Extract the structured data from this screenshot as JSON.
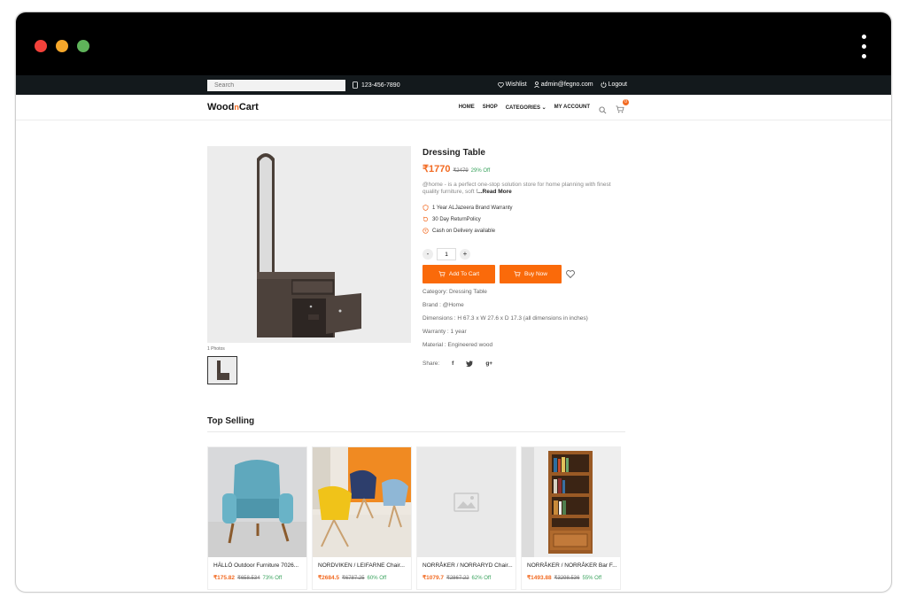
{
  "topbar": {
    "search_placeholder": "Search",
    "phone": "123-456-7890",
    "wishlist": "Wishlist",
    "email": "admin@fegno.com",
    "logout": "Logout"
  },
  "brand": {
    "part1": "Wood",
    "part2": "n",
    "part3": "Cart"
  },
  "nav": {
    "home": "HOME",
    "shop": "SHOP",
    "categories": "CATEGORIES",
    "account": "MY ACCOUNT",
    "cart_count": "0"
  },
  "product": {
    "title": "Dressing Table",
    "price": "₹1770",
    "mrp": "₹2479",
    "off": "29% Off",
    "desc": "@home - is a perfect one-stop solution store for home planning with finest quality furniture, soft f",
    "read_more": "...Read More",
    "features": [
      "1 Year ALJazeera Brand Warranty",
      "30 Day ReturnPolicy",
      "Cash on Delivery available"
    ],
    "qty": "1",
    "add_to_cart": "Add To Cart",
    "buy_now": "Buy Now",
    "meta": [
      "Category: Dressing Table",
      "Brand : @Home",
      "Dimensions : H 67.3 x W 27.6 x D 17.3 (all dimensions in inches)",
      "Warranty : 1 year",
      "Material : Engineered wood"
    ],
    "share_label": "Share:",
    "photos_label": "1 Photos"
  },
  "top_selling": {
    "title": "Top Selling",
    "items": [
      {
        "name": "HÄLLÖ Outdoor Furniture 7026...",
        "price": "₹175.82",
        "mrp": "₹658.534",
        "off": "73% Off"
      },
      {
        "name": "NORDVIKEN / LEIFARNE Chair...",
        "price": "₹2684.5",
        "mrp": "₹6787.25",
        "off": "60% Off"
      },
      {
        "name": "NORRÅKER / NORRARYD Chair...",
        "price": "₹1079.7",
        "mrp": "₹2867.22",
        "off": "62% Off"
      },
      {
        "name": "NORRÅKER / NORRÅKER Bar F...",
        "price": "₹1493.88",
        "mrp": "₹3298.536",
        "off": "55% Off"
      }
    ]
  },
  "colors": {
    "accent": "#f26a21",
    "button": "#fa6a0a",
    "discount": "#3aa35e",
    "topbar": "#13191c"
  }
}
